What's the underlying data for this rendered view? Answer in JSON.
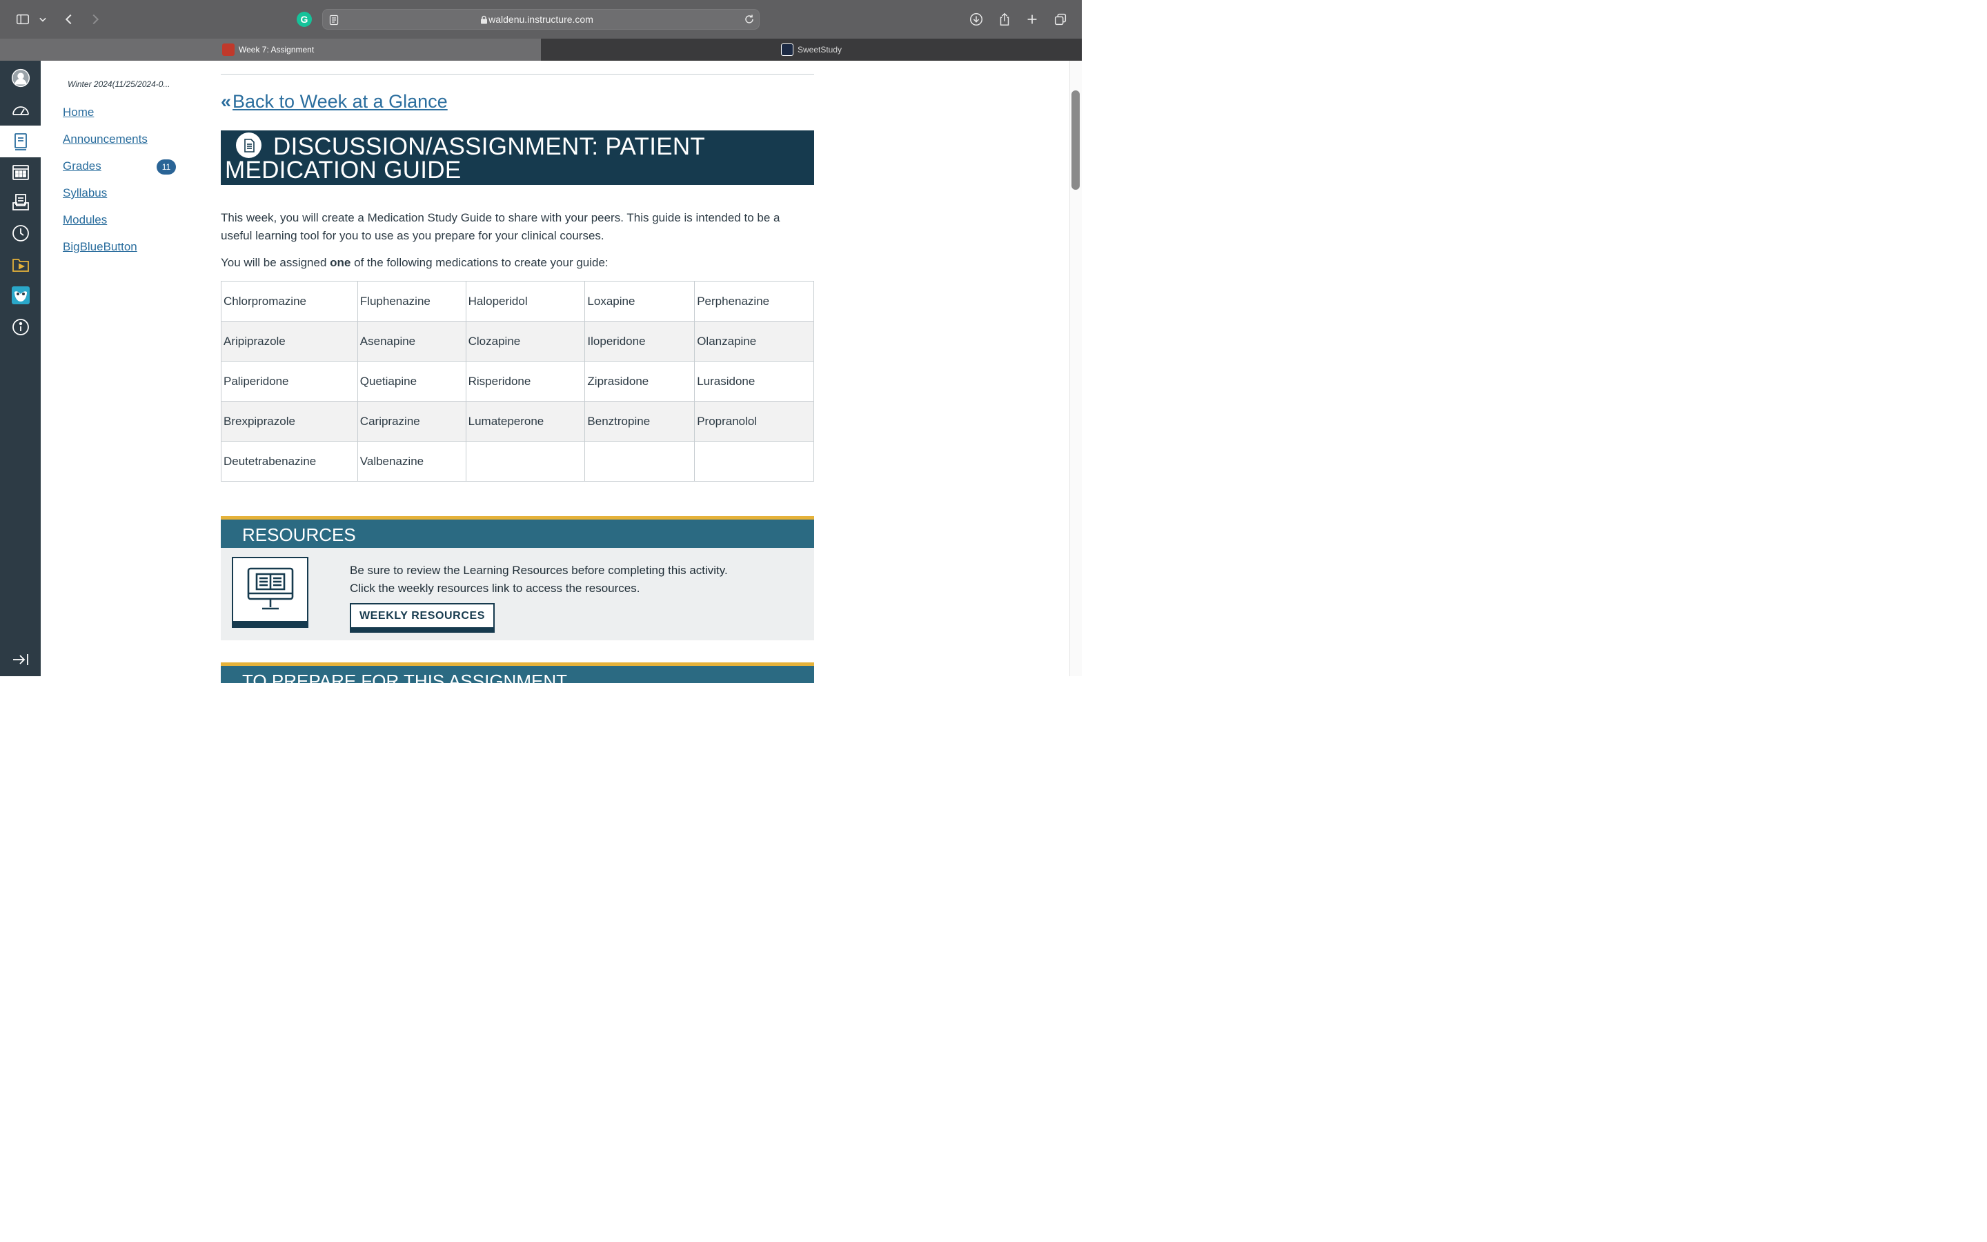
{
  "browser": {
    "url": "waldenu.instructure.com",
    "grammarly_letter": "G",
    "tabs": [
      {
        "title": "Week 7: Assignment",
        "active": true
      },
      {
        "title": "SweetStudy",
        "active": false
      }
    ]
  },
  "global_nav": {
    "items": [
      {
        "icon": "account-avatar-icon"
      },
      {
        "icon": "dashboard-icon"
      },
      {
        "icon": "courses-icon",
        "active": true
      },
      {
        "icon": "calendar-icon"
      },
      {
        "icon": "inbox-icon"
      },
      {
        "icon": "history-icon"
      },
      {
        "icon": "studio-icon"
      },
      {
        "icon": "owl-icon"
      },
      {
        "icon": "help-icon"
      }
    ],
    "collapse_icon": "collapse-nav-icon"
  },
  "course_nav": {
    "term": "Winter 2024(11/25/2024-0...",
    "links": [
      "Home",
      "Announcements",
      "Grades",
      "Syllabus",
      "Modules",
      "BigBlueButton"
    ],
    "grades_badge": "11"
  },
  "main": {
    "back_link": "Back to Week at a Glance",
    "banner": {
      "line1": "DISCUSSION/ASSIGNMENT: PATIENT",
      "line2": "MEDICATION GUIDE"
    },
    "intro": "This week, you will create a Medication Study Guide to share with your peers. This guide is intended to be a useful learning tool for you to use as you prepare for your clinical courses.",
    "assigned": {
      "before": "You will be assigned ",
      "bold": "one",
      "after": " of the following medications to create your guide:"
    },
    "medications": [
      [
        "Chlorpromazine",
        "Fluphenazine",
        "Haloperidol",
        "Loxapine",
        "Perphenazine"
      ],
      [
        "Aripiprazole",
        "Asenapine",
        "Clozapine",
        "Iloperidone",
        "Olanzapine"
      ],
      [
        "Paliperidone",
        "Quetiapine",
        "Risperidone",
        "Ziprasidone",
        "Lurasidone"
      ],
      [
        "Brexpiprazole",
        "Cariprazine",
        "Lumateperone",
        "Benztropine",
        "Propranolol"
      ],
      [
        "Deutetrabenazine",
        "Valbenazine",
        "",
        "",
        ""
      ]
    ],
    "resources": {
      "heading": "RESOURCES",
      "line1": "Be sure to review the Learning Resources before completing this activity.",
      "line2": "Click the weekly resources link to access the resources.",
      "button": "WEEKLY RESOURCES"
    },
    "prepare_heading": "TO PREPARE FOR THIS ASSIGNMENT"
  },
  "colors": {
    "nav_bg": "#2d3b45",
    "banner_bg": "#163a4e",
    "section_bar": "#2b6a82",
    "gold_accent": "#e5b23a",
    "link": "#2b6e9e"
  }
}
